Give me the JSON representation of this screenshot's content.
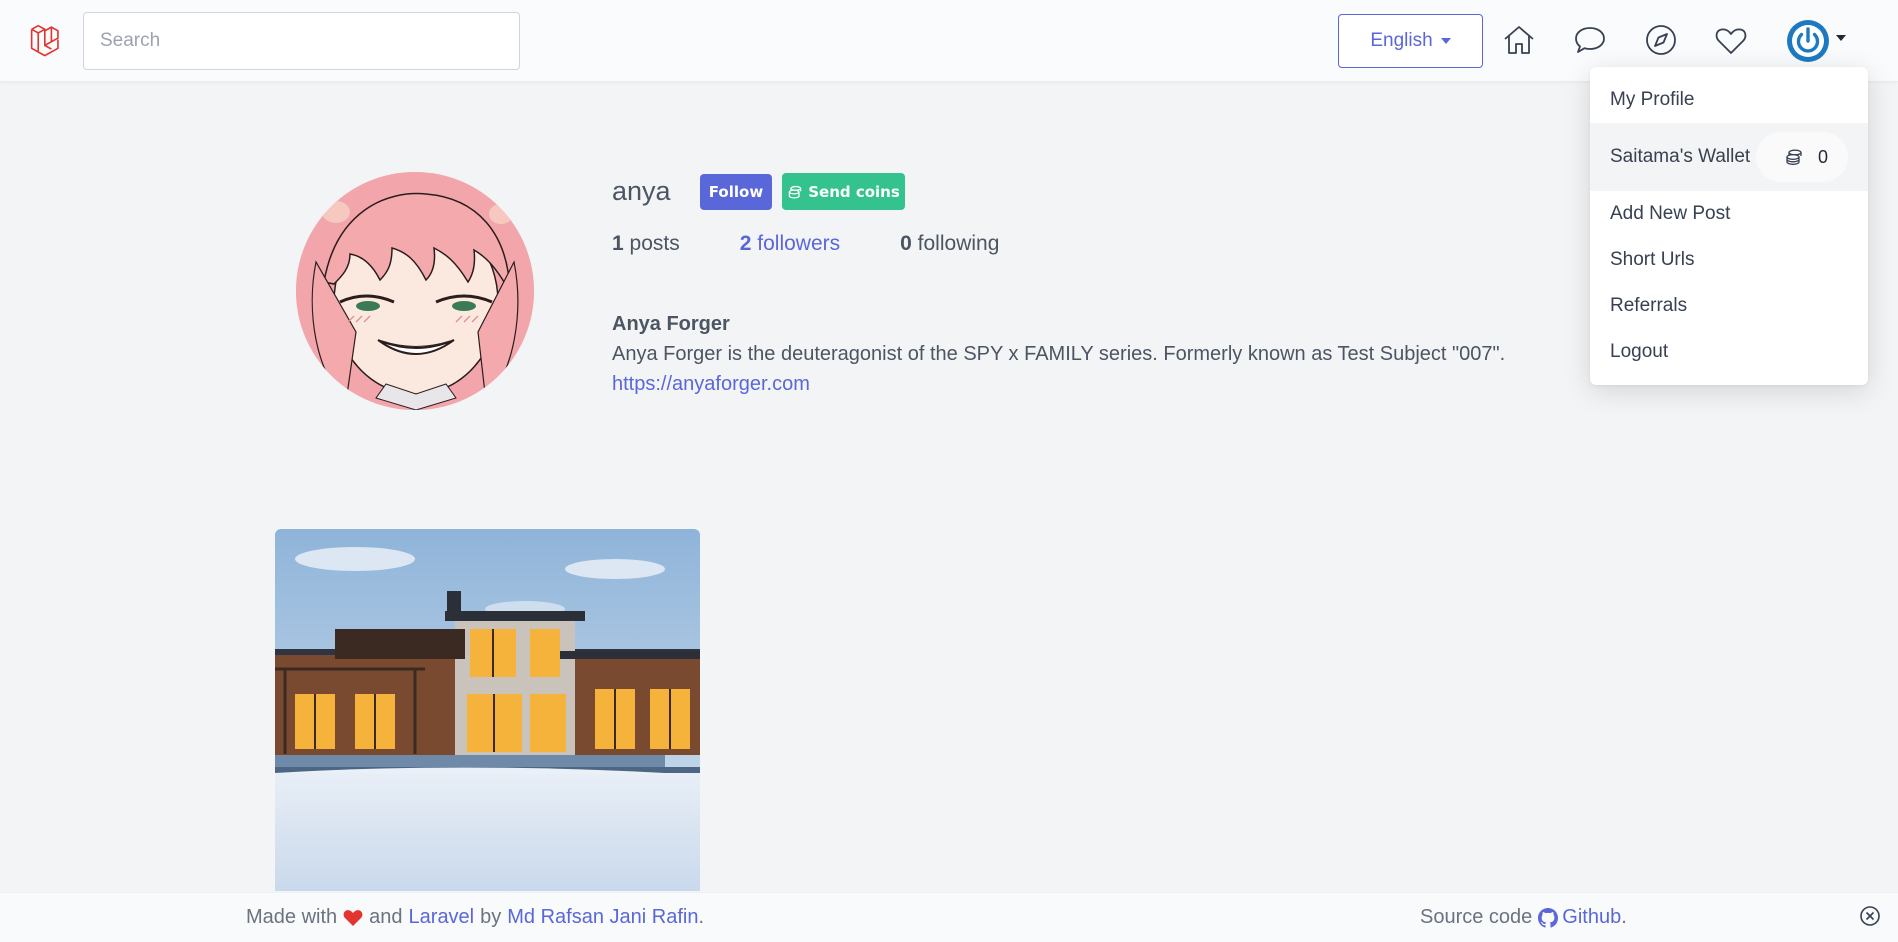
{
  "header": {
    "search_placeholder": "Search",
    "language": "English"
  },
  "menu": {
    "items": [
      {
        "label": "My Profile"
      },
      {
        "label": "Saitama's Wallet",
        "coins": "0"
      },
      {
        "label": "Add New Post"
      },
      {
        "label": "Short Urls"
      },
      {
        "label": "Referrals"
      },
      {
        "label": "Logout"
      }
    ]
  },
  "profile": {
    "username": "anya",
    "follow_label": "Follow",
    "send_coins_label": "Send coins",
    "posts_count": "1",
    "posts_label": "posts",
    "followers_count": "2",
    "followers_label": "followers",
    "following_count": "0",
    "following_label": "following",
    "full_name": "Anya Forger",
    "bio": "Anya Forger is the deuteragonist of the SPY x FAMILY series. Formerly known as Test Subject \"007\".",
    "website": "https://anyaforger.com"
  },
  "footer": {
    "made_with": "Made with",
    "and": "and",
    "laravel": "Laravel",
    "by": "by",
    "author": "Md Rafsan Jani Rafin",
    "period": ".",
    "source_code": "Source code",
    "github": "Github",
    "period2": "."
  },
  "colors": {
    "accent": "#5a67d8",
    "success": "#34c38f",
    "heart": "#e3342f",
    "avatar_blue": "#1d7ac2"
  }
}
